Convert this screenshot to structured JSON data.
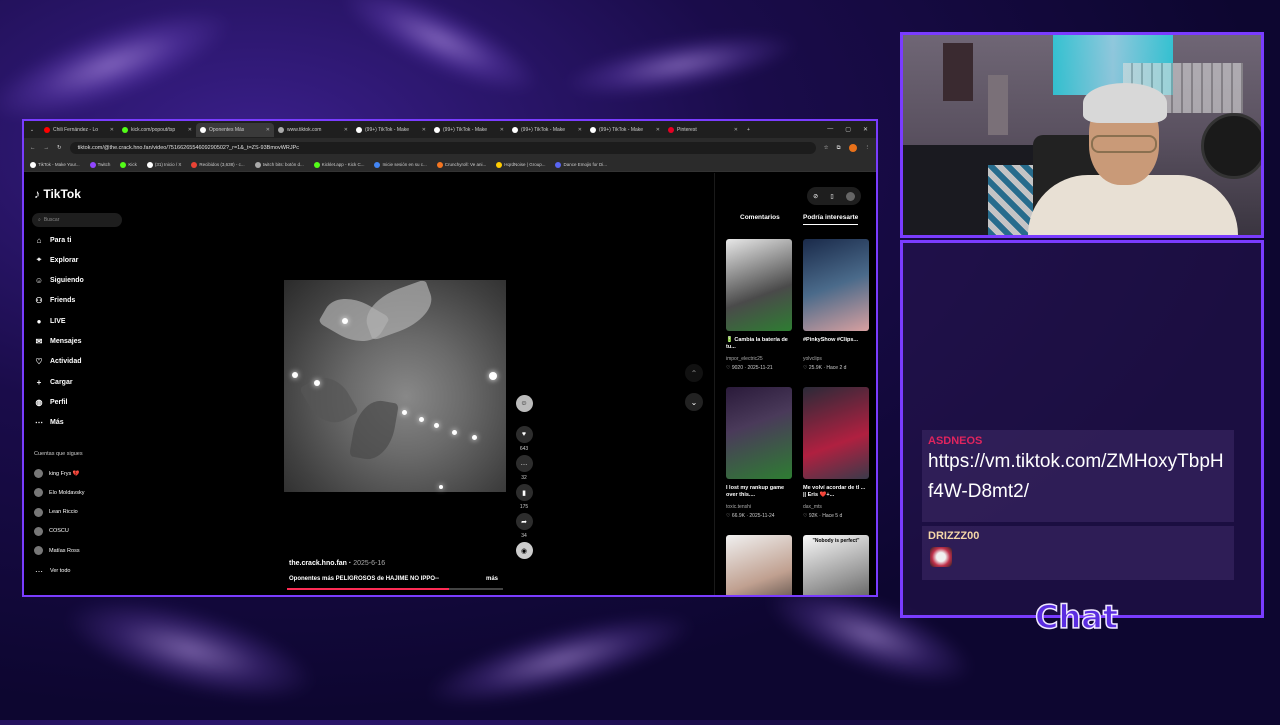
{
  "browser": {
    "tabs": [
      {
        "label": "Chili Fernández - Lo",
        "color": "#ff0000"
      },
      {
        "label": "kick.com/popout/tsp",
        "color": "#53fc18"
      },
      {
        "label": "Oponentes Más",
        "color": "#ffffff"
      },
      {
        "label": "www.tiktok.com",
        "color": "#aaaaaa"
      },
      {
        "label": "(99+) TikTok - Make",
        "color": "#ffffff"
      },
      {
        "label": "(99+) TikTok - Make",
        "color": "#ffffff"
      },
      {
        "label": "(99+) TikTok - Make",
        "color": "#ffffff"
      },
      {
        "label": "(99+) TikTok - Make",
        "color": "#ffffff"
      },
      {
        "label": "Pinterest",
        "color": "#e60023"
      }
    ],
    "url": "tiktok.com/@the.crack.hno.fan/video/7516626554609290502?_r=1&_t=ZS-93BmovWRJPc",
    "bookmarks": [
      {
        "label": "TikTok - Make Your...",
        "color": "#ffffff"
      },
      {
        "label": "Twitch",
        "color": "#9146ff"
      },
      {
        "label": "Kick",
        "color": "#53fc18"
      },
      {
        "label": "(31) Inicio / X",
        "color": "#ffffff"
      },
      {
        "label": "Recibidos (3,638) - c...",
        "color": "#ea4335"
      },
      {
        "label": "twitch bits: botón d...",
        "color": "#aaaaaa"
      },
      {
        "label": "Kicklet.app - Kick C...",
        "color": "#53fc18"
      },
      {
        "label": "Inicie sesión en su c...",
        "color": "#4285f4"
      },
      {
        "label": "Crunchyroll: Ve ani...",
        "color": "#f47521"
      },
      {
        "label": "HqrdNoise | Group...",
        "color": "#ffcc00"
      },
      {
        "label": "Dance Emojis for Di...",
        "color": "#5865f2"
      }
    ]
  },
  "tiktok": {
    "logo": "TikTok",
    "search_placeholder": "Buscar",
    "nav": [
      "Para ti",
      "Explorar",
      "Siguiendo",
      "Friends",
      "LIVE",
      "Mensajes",
      "Actividad",
      "Cargar",
      "Perfil",
      "Más"
    ],
    "following_header": "Cuentas que sigues",
    "following": [
      "king Frys 💔",
      "Elo Moldavsky",
      "Lean Riccio",
      "COSCU",
      "Matías Ross"
    ],
    "see_all": "Ver todo",
    "video": {
      "author": "the.crack.hno.fan",
      "date": "2025-6-16",
      "description": "Oponentes más PELIGROSOS de HAJIME NO IPPO--",
      "more": "más",
      "likes": "643",
      "comments": "32",
      "saves": "175",
      "shares": "34",
      "progress": 0.75
    },
    "right_tabs": [
      "Comentarios",
      "Podría interesarte"
    ],
    "suggestions": [
      {
        "caption": "🔋 Cambia la batería de tu...",
        "user": "impor_electric25",
        "stat": "♡ 9020 · 2025-11-21"
      },
      {
        "caption": "#PinkyShow #Clips...",
        "user": "yolvclips",
        "stat": "♡ 25.9K · Hace 2 d"
      },
      {
        "caption": "I lost my rankup game over this....",
        "user": "toxic.tenshi",
        "stat": "♡ 66.9K · 2025-11-24"
      },
      {
        "caption": "Me volví acordar de tl ... || Eris ❤️+...",
        "user": "dax_mts",
        "stat": "♡ 92K · Hace 5 d"
      },
      {
        "caption": "",
        "user": "",
        "stat": ""
      },
      {
        "caption": "\"Nobody is perfect\"",
        "user": "",
        "stat": ""
      }
    ]
  },
  "chat": {
    "messages": [
      {
        "user": "ASDNEOS",
        "user_color": "#e0245e",
        "text": "https://vm.tiktok.com/ZMHoxyTbpHf4W-D8mt2/"
      },
      {
        "user": "DRIZZZ00",
        "user_color": "#f5d7a8",
        "text": ""
      }
    ],
    "label": "Chat"
  }
}
